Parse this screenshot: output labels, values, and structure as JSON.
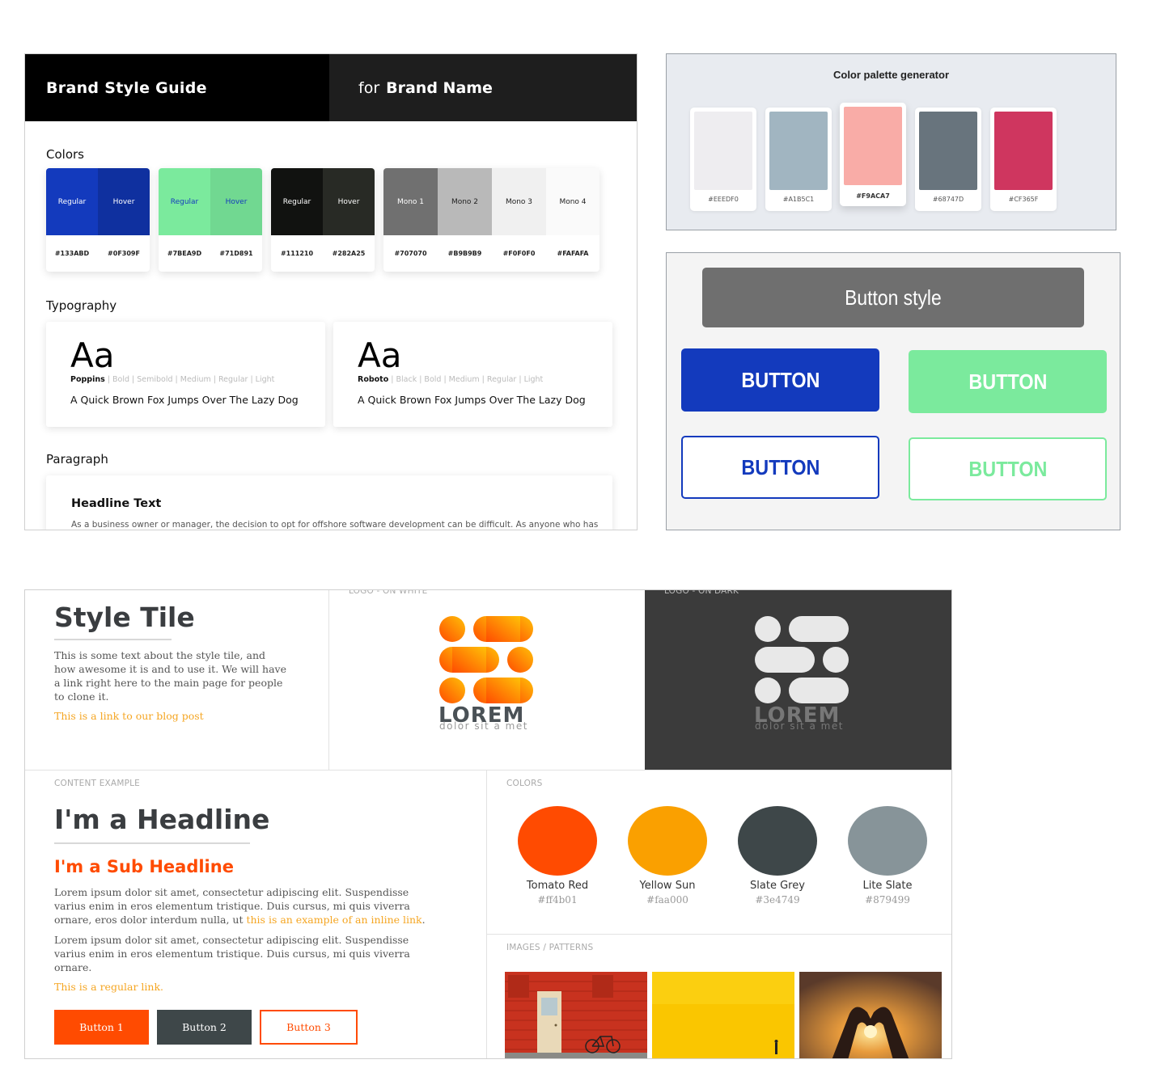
{
  "brand_guide": {
    "header_left": "Brand Style Guide",
    "header_for": "for",
    "header_brand": "Brand Name",
    "colors_heading": "Colors",
    "swatch_groups": [
      {
        "cols": [
          {
            "label": "Regular",
            "hex": "#133ABD",
            "color": "#133abd",
            "text_color": "#ffffff"
          },
          {
            "label": "Hover",
            "hex": "#0F309F",
            "color": "#0f309f",
            "text_color": "#ffffff"
          }
        ]
      },
      {
        "cols": [
          {
            "label": "Regular",
            "hex": "#7BEA9D",
            "color": "#7bea9d",
            "text_color": "#133abd"
          },
          {
            "label": "Hover",
            "hex": "#71D891",
            "color": "#71d891",
            "text_color": "#133abd"
          }
        ]
      },
      {
        "cols": [
          {
            "label": "Regular",
            "hex": "#111210",
            "color": "#111210",
            "text_color": "#ffffff"
          },
          {
            "label": "Hover",
            "hex": "#282A25",
            "color": "#282a25",
            "text_color": "#ffffff"
          }
        ]
      },
      {
        "cols": [
          {
            "label": "Mono 1",
            "hex": "#707070",
            "color": "#707070",
            "text_color": "#ffffff"
          },
          {
            "label": "Mono 2",
            "hex": "#B9B9B9",
            "color": "#b9b9b9",
            "text_color": "#222222"
          },
          {
            "label": "Mono 3",
            "hex": "#F0F0F0",
            "color": "#f0f0f0",
            "text_color": "#222222"
          },
          {
            "label": "Mono 4",
            "hex": "#FAFAFA",
            "color": "#fafafa",
            "text_color": "#222222"
          }
        ]
      }
    ],
    "typography_heading": "Typography",
    "type_cards": [
      {
        "aa": "Aa",
        "family": "Poppins",
        "weights": " | Bold | Semibold | Medium | Regular | Light",
        "sample": "A Quick Brown Fox Jumps Over The Lazy Dog"
      },
      {
        "aa": "Aa",
        "family": "Roboto",
        "weights": " | Black | Bold | Medium | Regular | Light",
        "sample": "A Quick Brown Fox Jumps Over The Lazy Dog"
      }
    ],
    "paragraph_heading": "Paragraph",
    "headline_text": "Headline Text",
    "paragraph_text": "As a business owner or manager, the decision to opt for offshore software development can be difficult. As anyone who has"
  },
  "palette": {
    "title": "Color palette generator",
    "swatches": [
      {
        "hex": "#EEEDF0",
        "color": "#eeedf0"
      },
      {
        "hex": "#A1B5C1",
        "color": "#a1b5c1"
      },
      {
        "hex": "#F9ACA7",
        "color": "#f9aca7"
      },
      {
        "hex": "#68747D",
        "color": "#68747d"
      },
      {
        "hex": "#CF365F",
        "color": "#cf365f"
      }
    ]
  },
  "button_style": {
    "banner": "Button style",
    "buttons": [
      "BUTTON",
      "BUTTON",
      "BUTTON",
      "BUTTON"
    ],
    "blue": "#133abd",
    "green": "#7bea9d"
  },
  "style_tile": {
    "title": "Style Tile",
    "intro": "This is some text about the style tile, and how awesome it is and to use it. We will have a link right here to the main page for people to clone it.",
    "blog_link": "This is a link to our blog post",
    "logo_on_white_label": "LOGO - ON WHITE",
    "logo_on_dark_label": "LOGO - ON DARK",
    "logo_word": "LOREM",
    "logo_tagline": "dolor sit a met",
    "content_label": "CONTENT EXAMPLE",
    "headline": "I'm a Headline",
    "subheadline": "I'm a Sub Headline",
    "para1": "Lorem ipsum dolor sit amet, consectetur adipiscing elit. Suspendisse varius enim in eros elementum tristique. Duis cursus, mi quis viverra ornare, eros dolor interdum nulla, ut ",
    "inline_link": "this is an example of an inline link",
    "para1_end": ".",
    "para2": "Lorem ipsum dolor sit amet, consectetur adipiscing elit. Suspendisse varius enim in eros elementum tristique. Duis cursus, mi quis viverra ornare.",
    "regular_link": "This is a regular link.",
    "buttons": [
      "Button 1",
      "Button 2",
      "Button 3"
    ],
    "colors_label": "COLORS",
    "colors": [
      {
        "name": "Tomato Red",
        "hex": "#ff4b01"
      },
      {
        "name": "Yellow Sun",
        "hex": "#faa000"
      },
      {
        "name": "Slate Grey",
        "hex": "#3e4749"
      },
      {
        "name": "Lite Slate",
        "hex": "#879499"
      }
    ],
    "images_label": "IMAGES / PATTERNS",
    "orange": "#ff4b01",
    "slate": "#3e4749"
  }
}
